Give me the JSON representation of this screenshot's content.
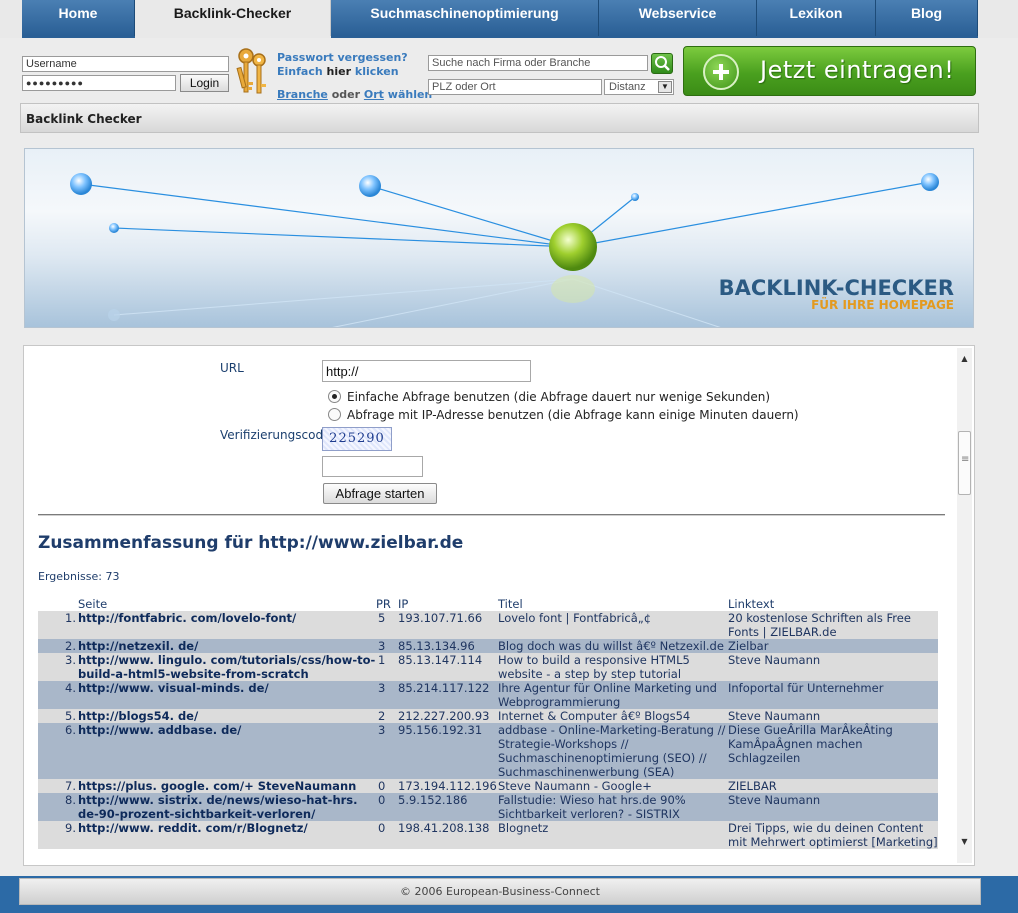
{
  "nav": {
    "tabs": [
      {
        "label": "Home"
      },
      {
        "label": "Backlink-Checker"
      },
      {
        "label": "Suchmaschinenoptimierung"
      },
      {
        "label": "Webservice"
      },
      {
        "label": "Lexikon"
      },
      {
        "label": "Blog"
      }
    ],
    "active": "Backlink-Checker"
  },
  "login": {
    "username": "Username",
    "password": "●●●●●●●●●",
    "login_label": "Login",
    "forgot_line1": "Passwort vergessen?",
    "forgot_line2_a": "Einfach",
    "forgot_line2_b": "hier",
    "forgot_line2_c": "klicken",
    "branch_a": "Branche",
    "branch_b": "oder",
    "branch_c": "Ort",
    "branch_d": "wählen"
  },
  "search": {
    "company_placeholder": "Suche nach Firma oder Branche",
    "location_placeholder": "PLZ oder Ort",
    "distance": "Distanz"
  },
  "cta": {
    "label": "Jetzt eintragen!"
  },
  "page_title": "Backlink Checker",
  "banner": {
    "title": "BACKLINK-CHECKER",
    "subtitle": "FÜR IHRE HOMEPAGE"
  },
  "form": {
    "url_label": "URL",
    "url_value": "http://",
    "option_simple": "Einfache Abfrage benutzen (die Abfrage dauert nur wenige Sekunden)",
    "option_ip": "Abfrage mit IP-Adresse benutzen (die Abfrage kann einige Minuten dauern)",
    "code_label": "Verifizierungscode",
    "captcha": "225290",
    "submit": "Abfrage starten"
  },
  "summary": {
    "heading": "Zusammenfassung für http://www.zielbar.de",
    "count_label": "Ergebnisse: 73"
  },
  "table": {
    "headers": {
      "site": "Seite",
      "pr": "PR",
      "ip": "IP",
      "title": "Titel",
      "linktext": "Linktext"
    },
    "rows": [
      {
        "n": "1.",
        "site": "http://fontfabric. com/lovelo-font/",
        "pr": "5",
        "ip": "193.107.71.66",
        "title": "Lovelo font | Fontfabricâ„¢",
        "linktext": "20 kostenlose Schriften als Free Fonts | ZIELBAR.de"
      },
      {
        "n": "2.",
        "site": "http://netzexil. de/",
        "pr": "3",
        "ip": "85.13.134.96",
        "title": "Blog doch was du willst â€º Netzexil.de",
        "linktext": "Zielbar"
      },
      {
        "n": "3.",
        "site": "http://www. lingulo. com/tutorials/css/how-to-build-a-html5-website-from-scratch",
        "pr": "1",
        "ip": "85.13.147.114",
        "title": "How to build a responsive HTML5 website - a step by step tutorial",
        "linktext": "Steve Naumann"
      },
      {
        "n": "4.",
        "site": "http://www. visual-minds. de/",
        "pr": "3",
        "ip": "85.214.117.122",
        "title": "Ihre Agentur für Online Marketing und Webprogrammierung",
        "linktext": "Infoportal für Unternehmer"
      },
      {
        "n": "5.",
        "site": "http://blogs54. de/",
        "pr": "2",
        "ip": "212.227.200.93",
        "title": "Internet & Computer â€º Blogs54",
        "linktext": "Steve Naumann"
      },
      {
        "n": "6.",
        "site": "http://www. addbase. de/",
        "pr": "3",
        "ip": "95.156.192.31",
        "title": "addbase - Online-Marketing-Beratung // Strategie-Workshops // Suchmaschinenoptimierung (SEO) // Suchmaschinenwerbung (SEA)",
        "linktext": "Diese GueÂrilla MarÂkeÂting KamÂpaÂgnen machen Schlagzeilen"
      },
      {
        "n": "7.",
        "site": "https://plus. google. com/+ SteveNaumann",
        "pr": "0",
        "ip": "173.194.112.196",
        "title": "Steve Naumann - Google+",
        "linktext": "ZIELBAR"
      },
      {
        "n": "8.",
        "site": "http://www. sistrix. de/news/wieso-hat-hrs. de-90-prozent-sichtbarkeit-verloren/",
        "pr": "0",
        "ip": "5.9.152.186",
        "title": "Fallstudie: Wieso hat hrs.de 90% Sichtbarkeit verloren? - SISTRIX",
        "linktext": "Steve Naumann"
      },
      {
        "n": "9.",
        "site": "http://www. reddit. com/r/Blognetz/",
        "pr": "0",
        "ip": "198.41.208.138",
        "title": "Blognetz",
        "linktext": "Drei Tipps, wie du deinen Content mit Mehrwert optimierst [Marketing]"
      }
    ]
  },
  "footer": "© 2006 European-Business-Connect",
  "colors": {
    "nav_blue": "#2a5f95",
    "cta_green": "#4aa01f",
    "row_alt": "#a9b7c9",
    "row": "#dcdcdc"
  }
}
